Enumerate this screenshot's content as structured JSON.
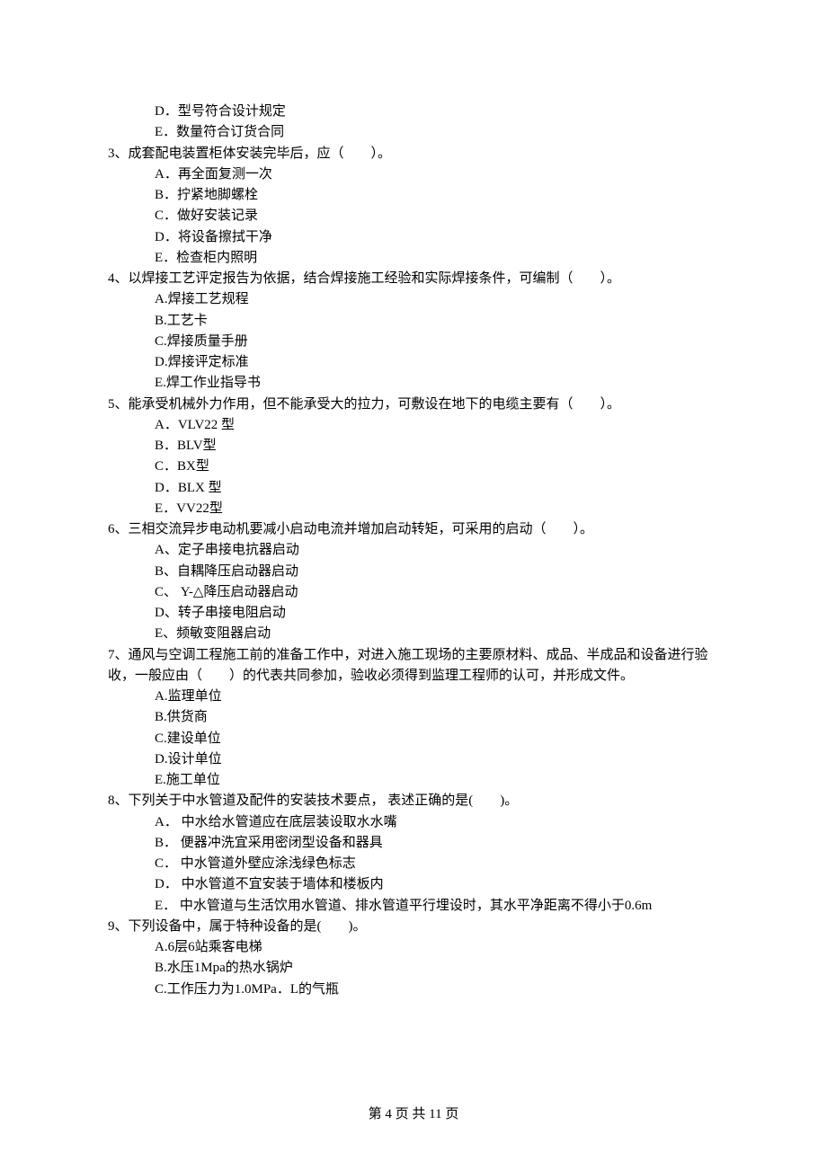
{
  "orphan_options": {
    "d": "D．型号符合设计规定",
    "e": "E．数量符合订货合同"
  },
  "q3": {
    "stem": "3、成套配电装置柜体安装完毕后，应（　　）。",
    "a": "A．再全面复测一次",
    "b": "B．拧紧地脚螺栓",
    "c": "C．做好安装记录",
    "d": "D．将设备擦拭干净",
    "e": "E．检查柜内照明"
  },
  "q4": {
    "stem": "4、以焊接工艺评定报告为依据，结合焊接施工经验和实际焊接条件，可编制（　　）。",
    "a": "A.焊接工艺规程",
    "b": "B.工艺卡",
    "c": "C.焊接质量手册",
    "d": "D.焊接评定标准",
    "e": "E.焊工作业指导书"
  },
  "q5": {
    "stem": "5、能承受机械外力作用，但不能承受大的拉力，可敷设在地下的电缆主要有（　　）。",
    "a": "A．VLV22 型",
    "b": "B．BLV型",
    "c": "C．BX型",
    "d": "D．BLX 型",
    "e": "E．VV22型"
  },
  "q6": {
    "stem": "6、三相交流异步电动机要减小启动电流并增加启动转矩，可采用的启动（　　）。",
    "a": "A、定子串接电抗器启动",
    "b": "B、自耦降压启动器启动",
    "c": "C、 Y-△降压启动器启动",
    "d": "D、转子串接电阻启动",
    "e": "E、频敏变阻器启动"
  },
  "q7": {
    "stem": "7、通风与空调工程施工前的准备工作中，对进入施工现场的主要原材料、成品、半成品和设备进行验收，一般应由（　　）的代表共同参加，验收必须得到监理工程师的认可，并形成文件。",
    "a": "A.监理单位",
    "b": "B.供货商",
    "c": "C.建设单位",
    "d": "D.设计单位",
    "e": "E.施工单位"
  },
  "q8": {
    "stem": "8、下列关于中水管道及配件的安装技术要点， 表述正确的是(　　)。",
    "a": "A． 中水给水管道应在底层装设取水水嘴",
    "b": "B． 便器冲洗宜采用密闭型设备和器具",
    "c": "C． 中水管道外壁应涂浅绿色标志",
    "d": "D． 中水管道不宜安装于墙体和楼板内",
    "e": "E． 中水管道与生活饮用水管道、排水管道平行埋设时，其水平净距离不得小于0.6m"
  },
  "q9": {
    "stem": "9、下列设备中，属于特种设备的是(　　)。",
    "a": "A.6层6站乘客电梯",
    "b": "B.水压1Mpa的热水锅炉",
    "c": "C.工作压力为1.0MPa．L的气瓶"
  },
  "footer": "第 4 页 共 11 页"
}
